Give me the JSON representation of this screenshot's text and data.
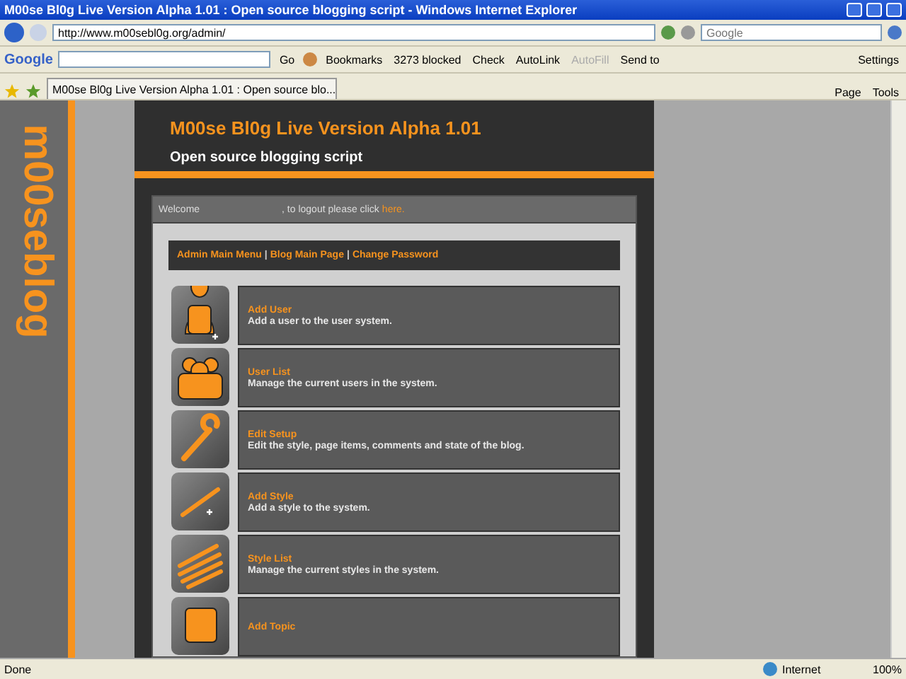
{
  "window": {
    "title": "M00se Bl0g Live Version Alpha 1.01 : Open source blogging script - Windows Internet Explorer"
  },
  "address_bar": {
    "url": "http://www.m00sebl0g.org/admin/"
  },
  "search": {
    "placeholder": "Google"
  },
  "google_toolbar": {
    "brand": "Google",
    "go": "Go",
    "items": [
      {
        "label": "Bookmarks",
        "disabled": false
      },
      {
        "label": "3273 blocked",
        "disabled": false
      },
      {
        "label": "Check",
        "disabled": false
      },
      {
        "label": "AutoLink",
        "disabled": false
      },
      {
        "label": "AutoFill",
        "disabled": true
      },
      {
        "label": "Send to",
        "disabled": false
      }
    ],
    "settings": "Settings"
  },
  "tabs": [
    {
      "label": "M00se Bl0g Live Version Alpha 1.01 : Open source blo...",
      "selected": true
    }
  ],
  "command_bar": {
    "items": [
      "Page",
      "Tools"
    ]
  },
  "page": {
    "logo": "m00seblog",
    "title": "M00se Bl0g Live Version Alpha 1.01",
    "subtitle": "Open source blogging script",
    "welcome": "Welcome",
    "logout_text": ", to logout please click",
    "logout_link": "here.",
    "menu": [
      "Admin Main Menu",
      "Blog Main Page",
      "Change Password"
    ],
    "separator": "|",
    "rows": [
      {
        "kind": "adduser",
        "title": "Add User",
        "description": "Add a user to the user system."
      },
      {
        "kind": "users",
        "title": "User List",
        "description": "Manage the current users in the system."
      },
      {
        "kind": "wrench",
        "title": "Edit Setup",
        "description": "Edit the style, page items, comments and state of the blog."
      },
      {
        "kind": "addbrush",
        "title": "Add Style",
        "description": "Add a style to the system."
      },
      {
        "kind": "brushes",
        "title": "Style List",
        "description": "Manage the current styles in the system."
      },
      {
        "kind": "topic",
        "title": "Add Topic",
        "description": ""
      }
    ]
  },
  "status_bar": {
    "text": "Done",
    "zone": "Internet",
    "zoom": "100%"
  }
}
